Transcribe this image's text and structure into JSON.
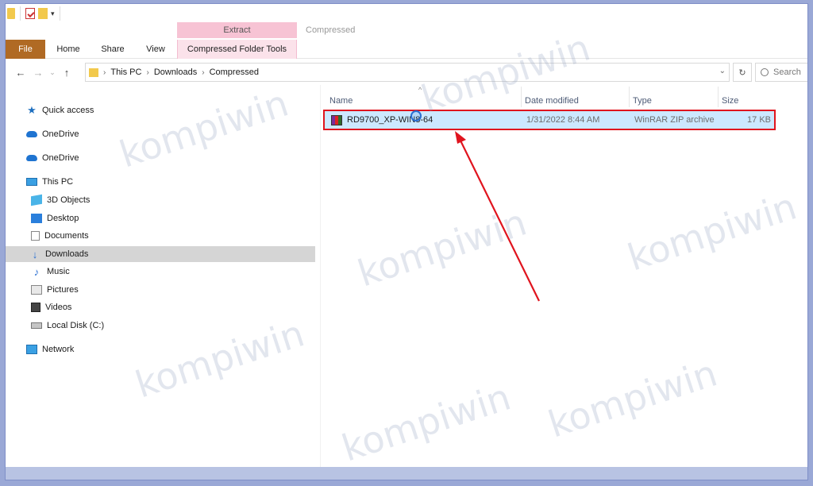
{
  "ribbon": {
    "contextual_header": "Extract",
    "window_title": "Compressed",
    "tabs": {
      "file": "File",
      "home": "Home",
      "share": "Share",
      "view": "View",
      "contextual": "Compressed Folder Tools"
    }
  },
  "address": {
    "crumbs": [
      "This PC",
      "Downloads",
      "Compressed"
    ],
    "search_placeholder": "Search"
  },
  "sidebar": {
    "items": [
      {
        "label": "Quick access",
        "icon": "star-icon"
      },
      {
        "label": "OneDrive",
        "icon": "cloud-icon"
      },
      {
        "label": "OneDrive",
        "icon": "cloud-icon"
      },
      {
        "label": "This PC",
        "icon": "computer-icon"
      },
      {
        "label": "3D Objects",
        "icon": "3d-objects-icon"
      },
      {
        "label": "Desktop",
        "icon": "desktop-icon"
      },
      {
        "label": "Documents",
        "icon": "documents-icon"
      },
      {
        "label": "Downloads",
        "icon": "download-arrow-icon",
        "selected": true
      },
      {
        "label": "Music",
        "icon": "music-note-icon"
      },
      {
        "label": "Pictures",
        "icon": "pictures-icon"
      },
      {
        "label": "Videos",
        "icon": "videos-icon"
      },
      {
        "label": "Local Disk (C:)",
        "icon": "drive-icon"
      },
      {
        "label": "Network",
        "icon": "network-icon"
      }
    ]
  },
  "columns": {
    "name": "Name",
    "date": "Date modified",
    "type": "Type",
    "size": "Size"
  },
  "files": [
    {
      "name": "RD9700_XP-WIN8-64",
      "date": "1/31/2022 8:44 AM",
      "type": "WinRAR ZIP archive",
      "size": "17 KB",
      "selected": true
    }
  ],
  "watermark": "kompiwin",
  "colors": {
    "file_tab": "#b06a24",
    "contextual_tab": "#f7c3d4",
    "selection": "#cce8ff",
    "highlight_border": "#e0141e",
    "annotation_arrow": "#e0141e"
  }
}
